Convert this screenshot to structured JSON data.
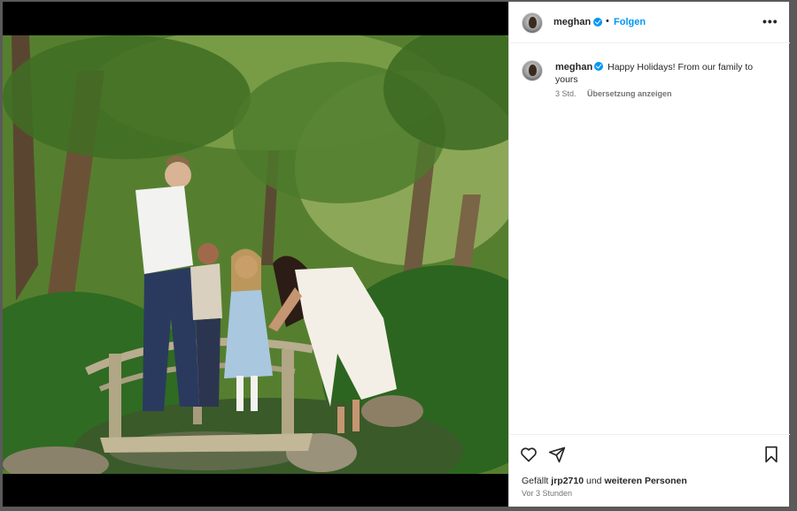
{
  "post": {
    "username": "meghan",
    "separator": "•",
    "follow_label": "Folgen",
    "more_label": "•••",
    "caption_user": "meghan",
    "caption_text": "Happy Holidays! From our family to yours",
    "age_short": "3 Std.",
    "translate_label": "Übersetzung anzeigen",
    "likes_prefix": "Gefällt",
    "likes_user": "jrp2710",
    "likes_join": "und",
    "likes_others": "weiteren Personen",
    "age_long": "Vor 3 Stunden"
  },
  "icons": {
    "verified": "verified-badge-icon",
    "like": "heart-icon",
    "share": "send-icon",
    "save": "bookmark-icon"
  },
  "colors": {
    "accent": "#0095f6",
    "text": "#262626",
    "muted": "#737373"
  }
}
